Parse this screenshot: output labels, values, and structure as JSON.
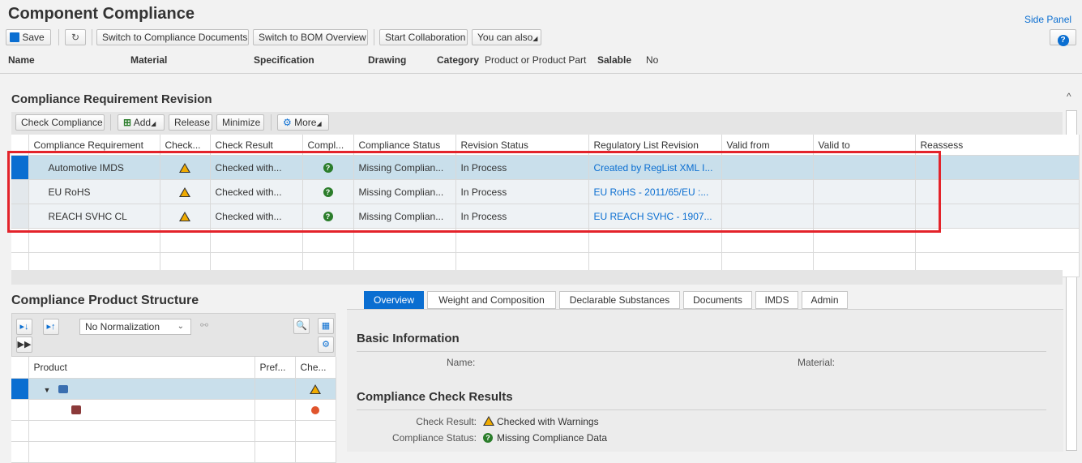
{
  "app": {
    "title": "Component Compliance",
    "side_panel": "Side Panel"
  },
  "toolbar": {
    "save": "Save",
    "switch_docs": "Switch to Compliance Documents",
    "switch_bom": "Switch to BOM Overview",
    "start_collab": "Start Collaboration",
    "you_can_also": "You can also"
  },
  "header_fields": {
    "name_label": "Name",
    "material_label": "Material",
    "spec_label": "Specification",
    "drawing_label": "Drawing",
    "category_label": "Category",
    "category_value": "Product or Product Part",
    "salable_label": "Salable",
    "salable_value": "No"
  },
  "req_section": {
    "title": "Compliance Requirement Revision",
    "buttons": {
      "check": "Check Compliance",
      "add": "Add",
      "release": "Release",
      "minimize": "Minimize",
      "more": "More"
    },
    "columns": [
      "Compliance Requirement",
      "Check...",
      "Check Result",
      "Compl...",
      "Compliance Status",
      "Revision Status",
      "Regulatory List Revision",
      "Valid from",
      "Valid to",
      "Reassess"
    ],
    "rows": [
      {
        "req": "Automotive IMDS",
        "result": "Checked with...",
        "status": "Missing Complian...",
        "revision": "In Process",
        "reglist": "Created by RegList XML I..."
      },
      {
        "req": "EU RoHS",
        "result": "Checked with...",
        "status": "Missing Complian...",
        "revision": "In Process",
        "reglist": "EU RoHS - 2011/65/EU :..."
      },
      {
        "req": "REACH SVHC CL",
        "result": "Checked with...",
        "status": "Missing Complian...",
        "revision": "In Process",
        "reglist": "EU REACH SVHC - 1907..."
      }
    ],
    "colors": {
      "warning": "#f0ab00",
      "ok": "#2b7d2b",
      "selected_row": "#c9dfeb",
      "highlight_box": "#e3232a"
    }
  },
  "structure": {
    "title": "Compliance Product Structure",
    "normalization": "No Normalization",
    "columns": [
      "Product",
      "Pref...",
      "Che..."
    ]
  },
  "tabs": [
    "Overview",
    "Weight and Composition",
    "Declarable Substances",
    "Documents",
    "IMDS",
    "Admin"
  ],
  "detail": {
    "basic_title": "Basic Information",
    "name_label": "Name:",
    "material_label": "Material:",
    "check_title": "Compliance Check Results",
    "check_result_label": "Check Result:",
    "check_result_value": "Checked with Warnings",
    "compliance_status_label": "Compliance Status:",
    "compliance_status_value": "Missing Compliance Data"
  }
}
